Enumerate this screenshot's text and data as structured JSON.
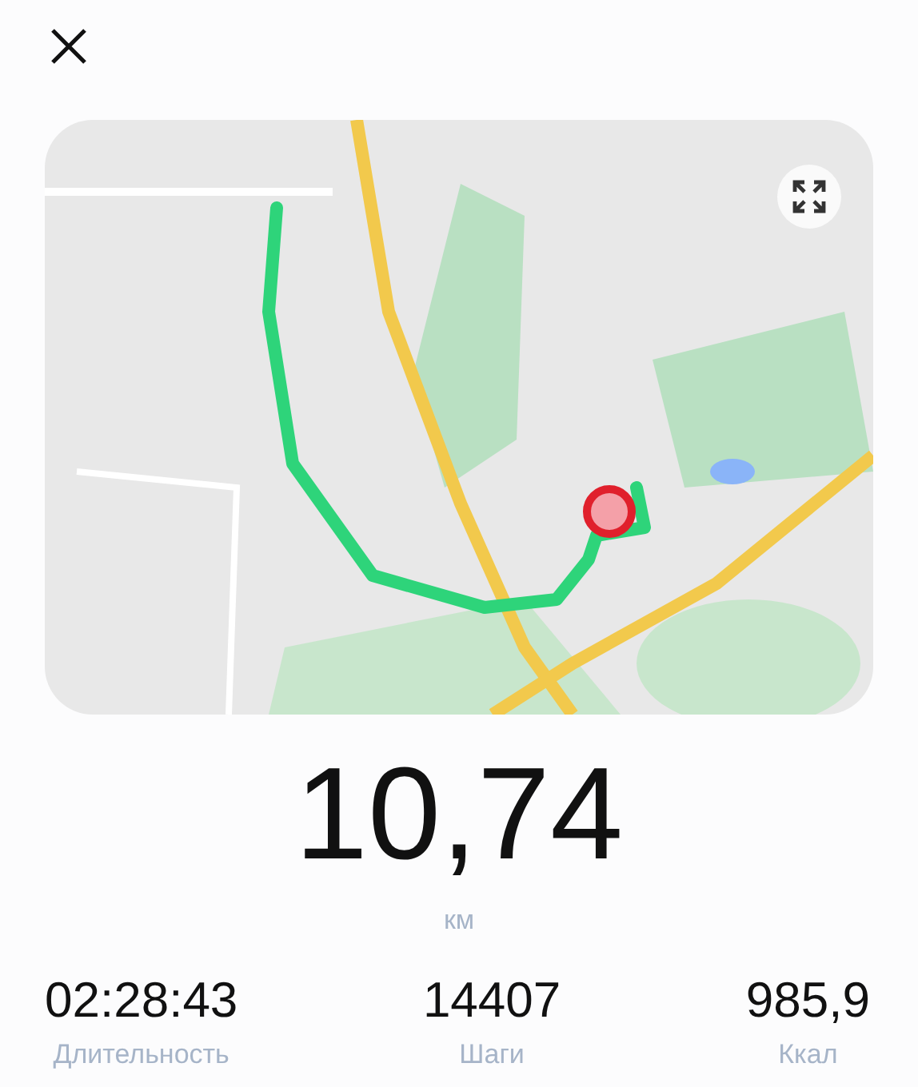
{
  "distance": {
    "value": "10,74",
    "unit": "км"
  },
  "stats": [
    {
      "value": "02:28:43",
      "label": "Длительность"
    },
    {
      "value": "14407",
      "label": "Шаги"
    },
    {
      "value": "985,9",
      "label": "Ккал"
    }
  ]
}
